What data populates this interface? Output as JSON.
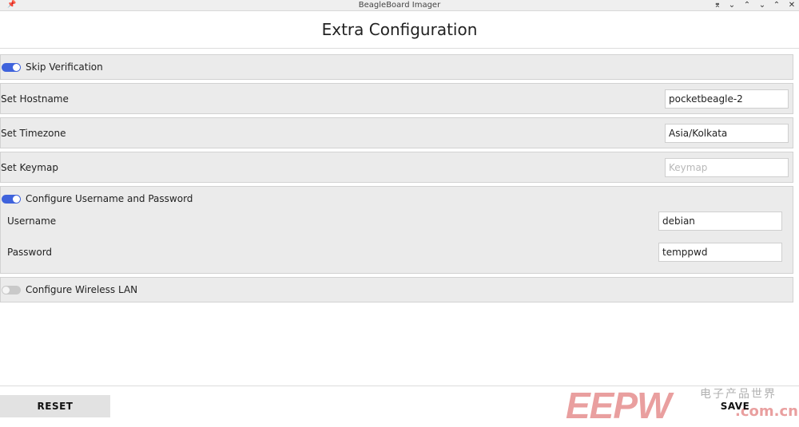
{
  "window": {
    "title": "BeagleBoard Imager",
    "pin_icon": "pin-icon",
    "controls": [
      "keep-below-icon",
      "keep-above-icon",
      "shade-icon",
      "minimize-icon",
      "maximize-icon",
      "close-icon"
    ]
  },
  "page": {
    "title": "Extra Configuration"
  },
  "skip_verification": {
    "label": "Skip Verification",
    "enabled": true
  },
  "hostname": {
    "label": "Set Hostname",
    "value": "pocketbeagle-2"
  },
  "timezone": {
    "label": "Set Timezone",
    "value": "Asia/Kolkata"
  },
  "keymap": {
    "label": "Set Keymap",
    "value": "",
    "placeholder": "Keymap"
  },
  "user_config": {
    "label": "Configure Username and Password",
    "enabled": true,
    "username_label": "Username",
    "username_value": "debian",
    "password_label": "Password",
    "password_value": "temppwd"
  },
  "wireless": {
    "label": "Configure Wireless LAN",
    "enabled": false
  },
  "buttons": {
    "reset": "RESET",
    "save": "SAVE"
  },
  "watermark": {
    "brand": "EEPW",
    "chinese": "电子产品世界",
    "url": ".com.cn"
  },
  "colors": {
    "toggle_on": "#3f63dc",
    "toggle_off": "#c9c9c9",
    "panel_bg": "#ebebeb"
  }
}
